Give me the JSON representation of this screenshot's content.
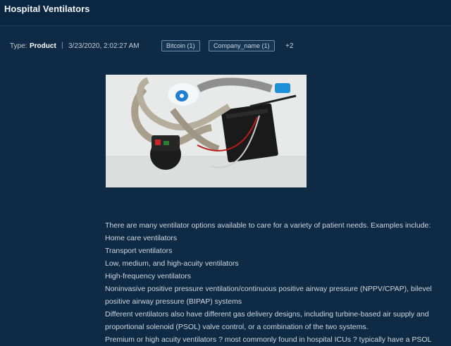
{
  "header": {
    "title": "Hospital Ventilators"
  },
  "meta": {
    "type_label": "Type:",
    "type_value": "Product",
    "separator": "|",
    "date": "3/23/2020, 2:02:27 AM",
    "tags": [
      "Bitcoin (1)",
      "Company_name (1)"
    ],
    "more": "+2"
  },
  "image": {
    "icon": "ventilator-device-photo"
  },
  "body": {
    "intro": " There are many ventilator options available to care for a variety of patient needs. Examples include:",
    "items": [
      "Home care ventilators",
      "Transport ventilators",
      "Low, medium, and high-acuity ventilators",
      "High-frequency ventilators",
      "Noninvasive positive pressure ventilation/continuous positive airway pressure (NPPV/CPAP), bilevel positive airway pressure (BIPAP) systems",
      "Different ventilators also have different gas delivery designs, including turbine-based air supply and proportional solenoid (PSOL) valve control, or a combination of the two systems.",
      "Premium or high acuity ventilators ? most commonly found in hospital ICUs ? typically have a PSOL"
    ]
  },
  "colors": {
    "background": "#0e2a45",
    "title_bar": "#0b2640",
    "tag_border": "#6d8aa8"
  }
}
